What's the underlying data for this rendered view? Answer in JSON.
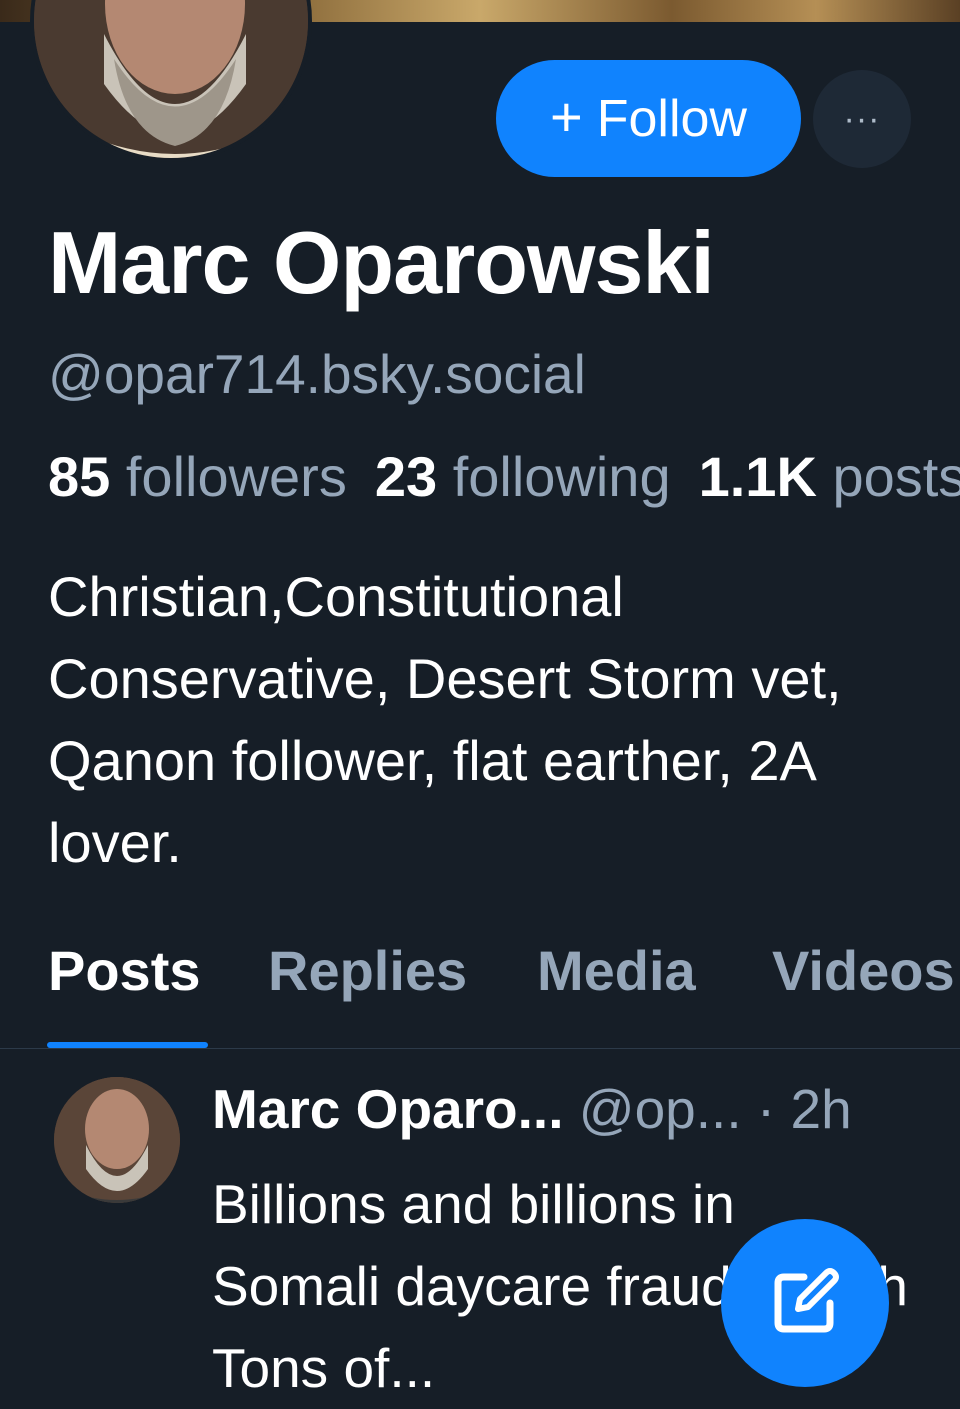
{
  "profile": {
    "display_name": "Marc Oparowski",
    "handle": "@opar714.bsky.social",
    "follow_label": "Follow",
    "more_label": "···",
    "stats": {
      "followers_count": "85",
      "followers_label": "followers",
      "following_count": "23",
      "following_label": "following",
      "posts_count": "1.1K",
      "posts_label": "posts"
    },
    "bio": "Christian,Constitutional Conservative, Desert Storm vet, Qanon follower, flat earther, 2A lover."
  },
  "tabs": [
    {
      "label": "Posts",
      "active": true
    },
    {
      "label": "Replies",
      "active": false
    },
    {
      "label": "Media",
      "active": false
    },
    {
      "label": "Videos",
      "active": false
    }
  ],
  "post": {
    "author": "Marc Oparo...",
    "handle": "@op...",
    "separator": "·",
    "time": "2h",
    "text": "Billions and billions in Somali daycare fraud. Worth Tons of..."
  },
  "colors": {
    "background": "#161e27",
    "accent": "#1083fe",
    "muted_text": "#95a6b9"
  },
  "icons": {
    "follow": "plus-icon",
    "more": "ellipsis-icon",
    "compose": "pencil-square-icon"
  }
}
